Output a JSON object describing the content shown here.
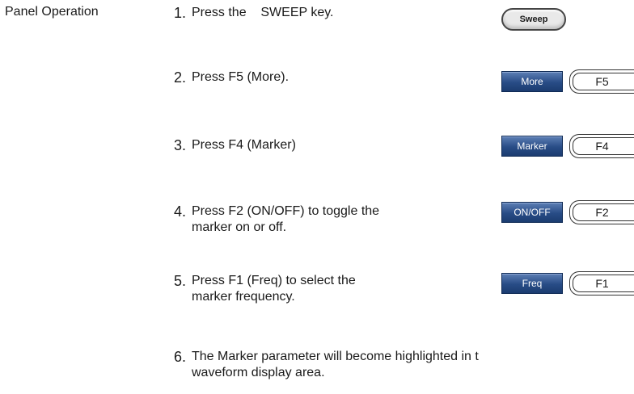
{
  "section_label": "Panel Operation",
  "steps": [
    {
      "num": "1.",
      "line1": "Press the    SWEEP key.",
      "line2": ""
    },
    {
      "num": "2.",
      "line1": "Press F5 (More).",
      "line2": ""
    },
    {
      "num": "3.",
      "line1": "Press F4 (Marker)",
      "line2": ""
    },
    {
      "num": "4.",
      "line1": "Press F2 (ON/OFF) to toggle the",
      "line2": "marker on or off."
    },
    {
      "num": "5.",
      "line1": "Press F1 (Freq) to select the",
      "line2": "marker frequency."
    },
    {
      "num": "6.",
      "line1": "The Marker parameter will become highlighted in t",
      "line2": "waveform display area."
    }
  ],
  "keys": {
    "sweep": "Sweep",
    "more": {
      "soft": "More",
      "f": "F5"
    },
    "marker": {
      "soft": "Marker",
      "f": "F4"
    },
    "onoff": {
      "soft": "ON/OFF",
      "f": "F2"
    },
    "freq": {
      "soft": "Freq",
      "f": "F1"
    }
  }
}
